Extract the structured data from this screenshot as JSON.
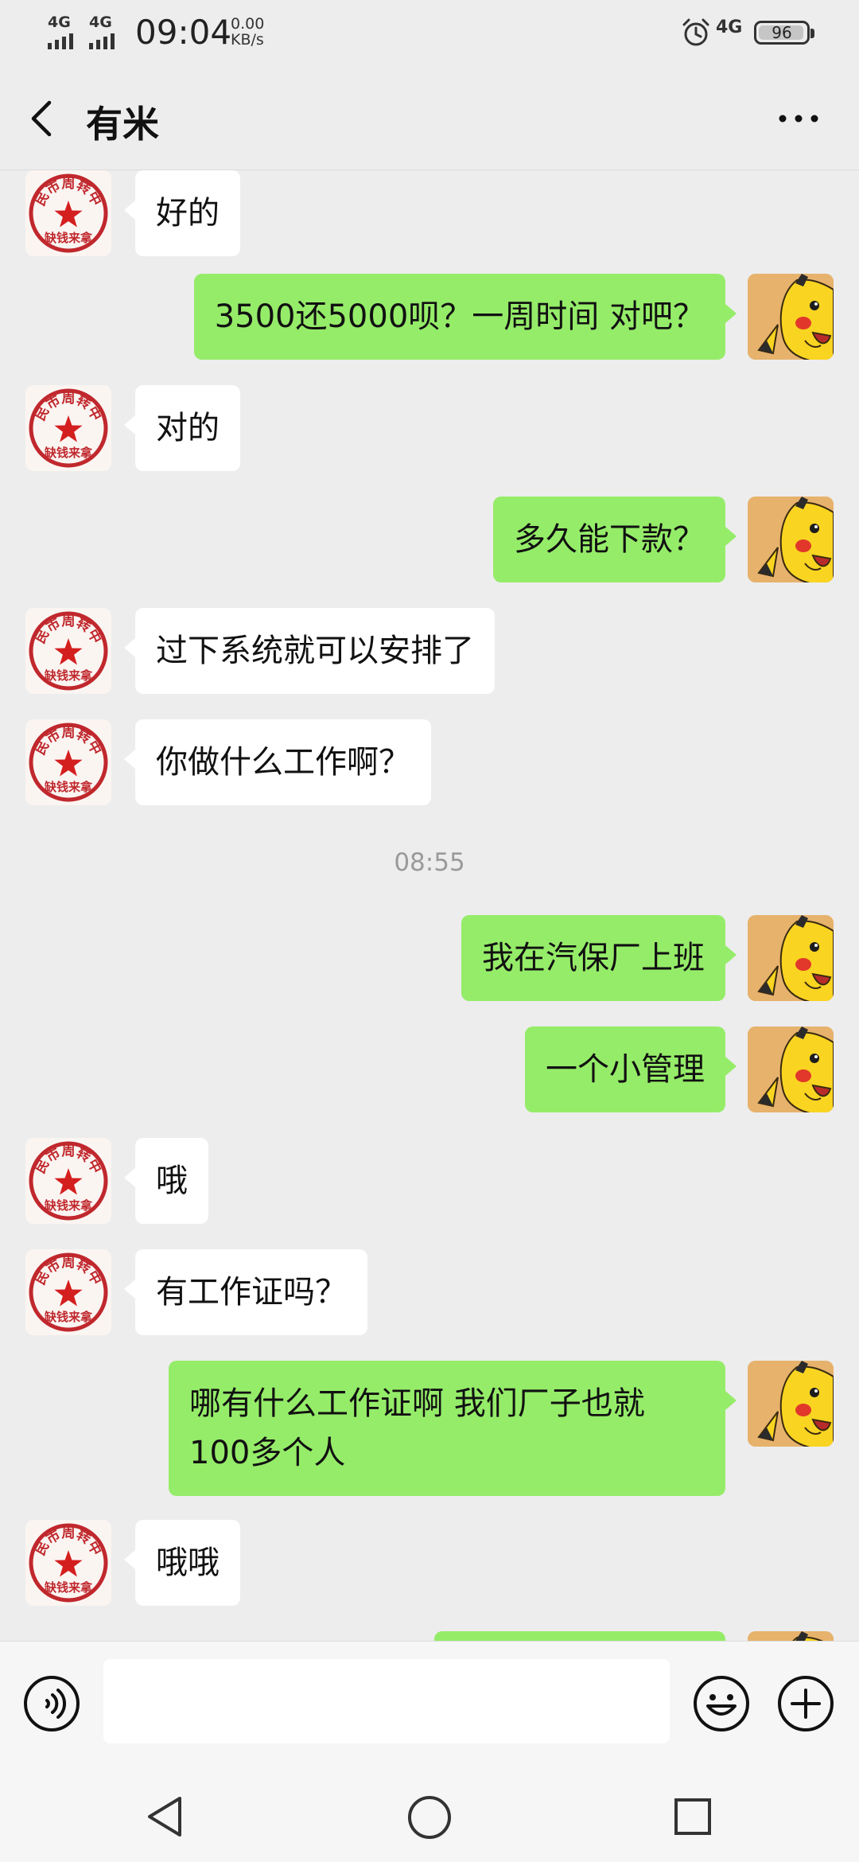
{
  "status_bar": {
    "network_1": "4G",
    "network_2": "4G",
    "time": "09:04",
    "speed_value": "0.00",
    "speed_unit": "KB/s",
    "network_right": "4G",
    "battery": "96",
    "battery_level_percent": 96
  },
  "header": {
    "title": "有米"
  },
  "stamp": {
    "circle_text": "人民市周转中心",
    "bottom_text": "缺钱来拿",
    "color": "#c0282d"
  },
  "colors": {
    "sent_bubble": "#95ec69",
    "received_bubble": "#ffffff",
    "background": "#ededed"
  },
  "messages": [
    {
      "side": "left",
      "text": "好的"
    },
    {
      "side": "right",
      "text": "3500还5000呗？一周时间 对吧？"
    },
    {
      "side": "left",
      "text": "对的"
    },
    {
      "side": "right",
      "text": "多久能下款？"
    },
    {
      "side": "left",
      "text": "过下系统就可以安排了"
    },
    {
      "side": "left",
      "text": "你做什么工作啊？"
    },
    {
      "type": "time",
      "text": "08:55"
    },
    {
      "side": "right",
      "text": "我在汽保厂上班"
    },
    {
      "side": "right",
      "text": "一个小管理"
    },
    {
      "side": "left",
      "text": "哦"
    },
    {
      "side": "left",
      "text": "有工作证吗？"
    },
    {
      "side": "right",
      "text": "哪有什么工作证啊 我们厂子也就100多个人"
    },
    {
      "side": "left",
      "text": "哦哦"
    }
  ],
  "input": {
    "value": ""
  }
}
